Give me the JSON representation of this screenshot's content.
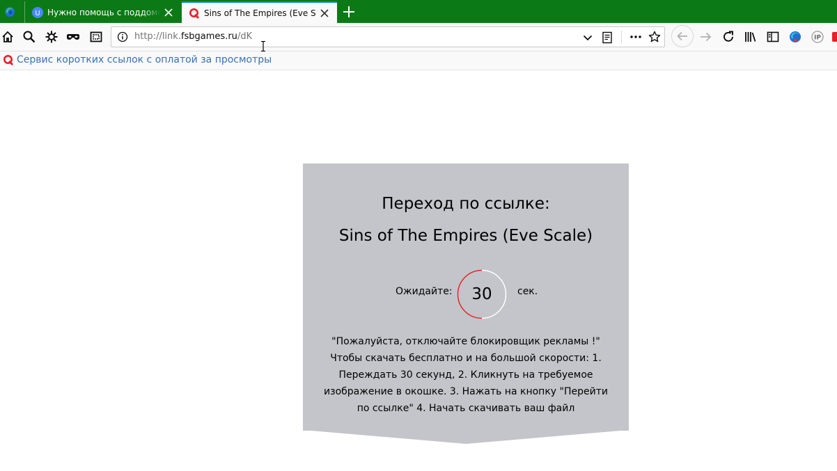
{
  "browser": {
    "tabs": [
      {
        "title": "Нужно помощь с поддоменом",
        "favicon_letter": "U",
        "active": false
      },
      {
        "title": "Sins of The Empires (Eve Scale)",
        "favicon_letter": "Q",
        "active": true
      }
    ],
    "url": {
      "scheme": "http://link.",
      "host": "fsbgames.ru",
      "path": "/dK"
    },
    "toolbar_icons": [
      "home-icon",
      "search-icon",
      "gear-icon",
      "mask-icon",
      "screenshot-icon"
    ],
    "right_icons": [
      "back-icon",
      "forward-icon",
      "reload-icon",
      "library-icon",
      "sidebar-icon",
      "extension-icon",
      "ip-icon",
      "addon-icon"
    ],
    "ip_icon_text": "IP"
  },
  "bookmarks": [
    {
      "label": "Сервис коротких ссылок с оплатой за просмотры",
      "favicon_letter": "Q"
    }
  ],
  "page": {
    "heading": "Переход по ссылке:",
    "target_title": "Sins of The Empires (Eve Scale)",
    "wait_label": "Ожидайте:",
    "countdown": "30",
    "seconds_label": "сек.",
    "description": "\"Пожалуйста, отключайте блокировщик рекламы !\" Чтобы скачать бесплатно и на большой скорости: 1. Переждать 30 секунд, 2. Кликнуть на требуемое изображение в окошке. 3. Нажать на кнопку \"Перейти по ссылке\" 4. Начать скачивать ваш файл"
  },
  "colors": {
    "tabbar": "#0b7a16",
    "active_tab_accent": "#0a84ff",
    "card_bg": "#c3c5ca",
    "timer_ring": "#e02020",
    "bookmark_text": "#3b6fb6",
    "favicon_red": "#e5202a"
  }
}
